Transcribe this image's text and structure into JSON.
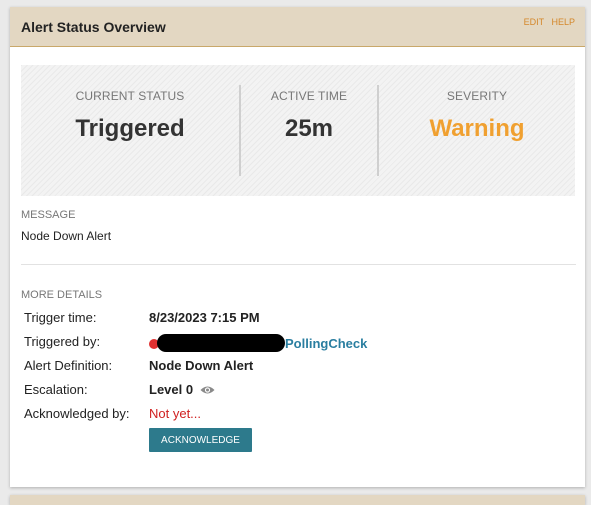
{
  "panel": {
    "title": "Alert Status Overview",
    "links": [
      "EDIT",
      "HELP"
    ]
  },
  "status": {
    "current_status_label": "CURRENT STATUS",
    "current_status_value": "Triggered",
    "active_time_label": "ACTIVE TIME",
    "active_time_value": "25m",
    "severity_label": "SEVERITY",
    "severity_value": "Warning",
    "severity_color": "#f0a030"
  },
  "message": {
    "label": "MESSAGE",
    "text": "Node Down Alert"
  },
  "details": {
    "label": "MORE DETAILS",
    "trigger_time_label": "Trigger time:",
    "trigger_time_value": "8/23/2023 7:15 PM",
    "triggered_by_label": "Triggered by:",
    "triggered_by_value": "PollingCheck",
    "alert_definition_label": "Alert Definition:",
    "alert_definition_value": "Node Down Alert",
    "escalation_label": "Escalation:",
    "escalation_value": "Level 0",
    "acknowledged_by_label": "Acknowledged by:",
    "acknowledged_by_value": "Not yet...",
    "acknowledge_button": "ACKNOWLEDGE"
  },
  "icons": {
    "node_status": "red-status-dot-icon",
    "escalation_view": "eye-icon"
  },
  "colors": {
    "header_bg": "#e3d7c2",
    "header_links": "#d4872a",
    "link": "#2a7ea0",
    "not_yet": "#d02020",
    "button": "#2d7a8c"
  }
}
